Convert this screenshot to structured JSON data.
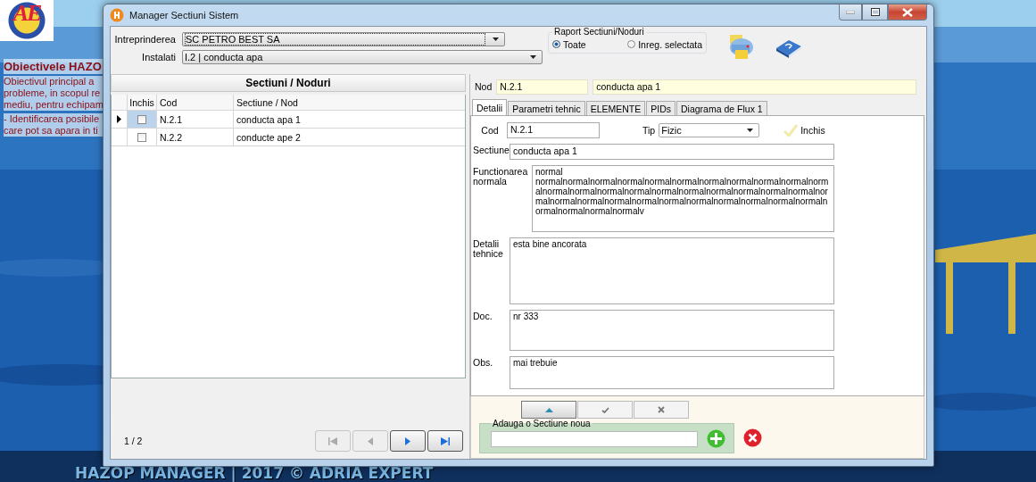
{
  "desktop": {
    "logo": "AE",
    "heading": "Obiectivele HAZO",
    "lines": [
      "Obiectivul principal a",
      "probleme, in scopul re",
      "mediu, pentru echipam",
      "- Identificarea posibile",
      "care pot sa apara in ti"
    ],
    "footer": "HAZOP MANAGER | 2017 © ADRIA EXPERT"
  },
  "window": {
    "title": "Manager Sectiuni Sistem"
  },
  "filters": [
    {
      "label": "Intreprinderea",
      "value": "SC PETRO BEST SA",
      "focused": true
    },
    {
      "label": "Instalati",
      "value": "I.2 | conducta apa",
      "focused": false
    }
  ],
  "report": {
    "title": "Raport Sectiuni/Noduri",
    "options": [
      {
        "label": "Toate",
        "selected": true
      },
      {
        "label": "Inreg. selectata",
        "selected": false
      }
    ]
  },
  "grid": {
    "title": "Sectiuni / Noduri",
    "columns": [
      "Inchis",
      "Cod",
      "Sectiune / Nod"
    ],
    "rows": [
      {
        "selected": true,
        "checked": false,
        "cod": "N.2.1",
        "sectiune": "conducta apa 1"
      },
      {
        "selected": false,
        "checked": false,
        "cod": "N.2.2",
        "sectiune": "conducte ape 2"
      }
    ],
    "page": "1 / 2",
    "nav_buttons": [
      {
        "kind": "first",
        "disabled": true
      },
      {
        "kind": "prev",
        "disabled": true
      },
      {
        "kind": "next",
        "disabled": false
      },
      {
        "kind": "last",
        "disabled": false
      }
    ]
  },
  "node": {
    "label": "Nod",
    "code": "N.2.1",
    "name": "conducta apa 1"
  },
  "tabs": [
    {
      "label": "Detalii",
      "selected": true
    },
    {
      "label": "Parametri tehnic",
      "selected": false
    },
    {
      "label": "ELEMENTE",
      "selected": false
    },
    {
      "label": "PIDs",
      "selected": false
    },
    {
      "label": "Diagrama de Flux 1",
      "selected": false
    }
  ],
  "details": {
    "cod": {
      "label": "Cod",
      "value": "N.2.1"
    },
    "tip": {
      "label": "Tip",
      "value": "Fizic"
    },
    "inchis": {
      "label": "Inchis",
      "checked": false
    },
    "fields": [
      {
        "kind": "line",
        "label": "Sectiune",
        "value": "conducta apa 1"
      },
      {
        "kind": "area",
        "label": "Functionarea normala",
        "value": "normal\nnormalnormalnormalnormalnormalnormalnormalnormalnormalnormalnormalnormalnormalnormalnormalnormalnormalnormalnormalnormalnormalnormalnormalnormalnormalnormalnormalnormalnormalnormalnormalnormalnormalnormalnormalnormalv"
      },
      {
        "kind": "area",
        "label": "Detalii tehnice",
        "value": "esta bine ancorata"
      },
      {
        "kind": "area",
        "label": "Doc.",
        "value": "nr 333"
      },
      {
        "kind": "area",
        "label": "Obs.",
        "value": "mai trebuie"
      }
    ]
  },
  "edit_buttons": [
    {
      "kind": "up",
      "disabled": false
    },
    {
      "kind": "save",
      "disabled": true
    },
    {
      "kind": "cancel",
      "disabled": true
    }
  ],
  "new_section": {
    "title": "Adauga o Sectiune noua"
  }
}
